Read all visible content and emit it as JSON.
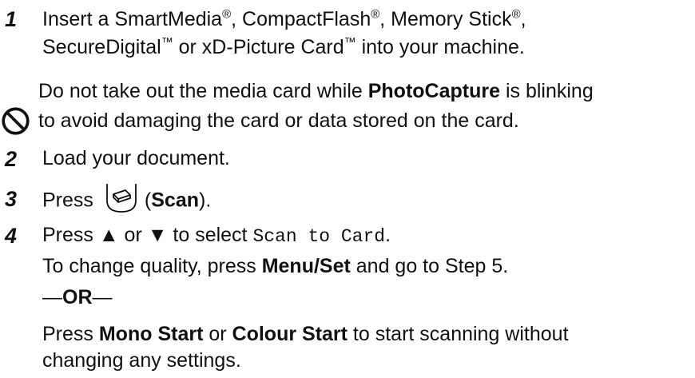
{
  "step1": {
    "number": "1",
    "line1_a": "Insert a SmartMedia",
    "line1_b": ", CompactFlash",
    "line1_c": ", Memory Stick",
    "line1_d": ",",
    "line2_a": "SecureDigital",
    "line2_b": " or xD-Picture Card",
    "line2_c": " into your machine.",
    "reg_mark": "®",
    "tm_mark": "™"
  },
  "note": {
    "icon": "no-entry-icon",
    "line1_a": "Do not take out the media card while ",
    "line1_b": "PhotoCapture",
    "line1_c": " is blinking",
    "line2": "to avoid damaging the card or data stored on the card."
  },
  "step2": {
    "number": "2",
    "text": "Load your document."
  },
  "step3": {
    "number": "3",
    "text_a": "Press",
    "button_icon": "scan-key-icon",
    "text_b": "(",
    "key": "Scan",
    "text_c": ")."
  },
  "step4": {
    "number": "4",
    "line1_a": "Press ▲ or ▼ to select ",
    "line1_option": "Scan to Card",
    "line1_b": ".",
    "line2_a": "To change quality, press ",
    "line2_key": "Menu/Set",
    "line2_b": " and go to Step 5.",
    "or_a": "—",
    "or_b": "OR",
    "or_c": "—",
    "line4_a": "Press ",
    "line4_key1": "Mono Start",
    "line4_b": " or ",
    "line4_key2": "Colour Start",
    "line4_c": " to start scanning without",
    "line5": "changing any settings."
  }
}
